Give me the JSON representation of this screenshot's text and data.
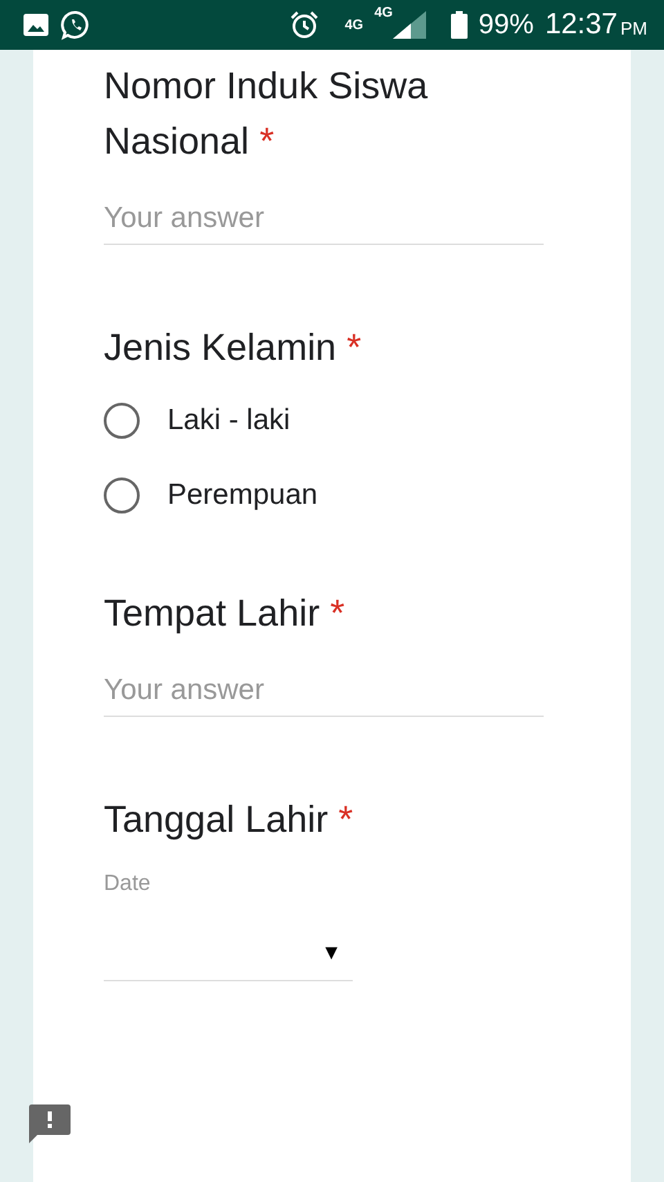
{
  "status_bar": {
    "network_small": "4G",
    "network": "4G",
    "battery": "99%",
    "time": "12:37",
    "ampm": "PM"
  },
  "questions": [
    {
      "kind": "text",
      "title": "Nomor Induk Siswa Nasional",
      "required_mark": "*",
      "placeholder": "Your answer"
    },
    {
      "kind": "radio",
      "title": "Jenis Kelamin",
      "required_mark": "*",
      "options": [
        {
          "label": "Laki - laki",
          "selected": false
        },
        {
          "label": "Perempuan",
          "selected": false
        }
      ]
    },
    {
      "kind": "text",
      "title": "Tempat Lahir",
      "required_mark": "*",
      "placeholder": "Your answer"
    },
    {
      "kind": "date",
      "title": "Tanggal Lahir",
      "required_mark": "*",
      "sublabel": "Date",
      "dropdown_arrow": "▼"
    }
  ]
}
